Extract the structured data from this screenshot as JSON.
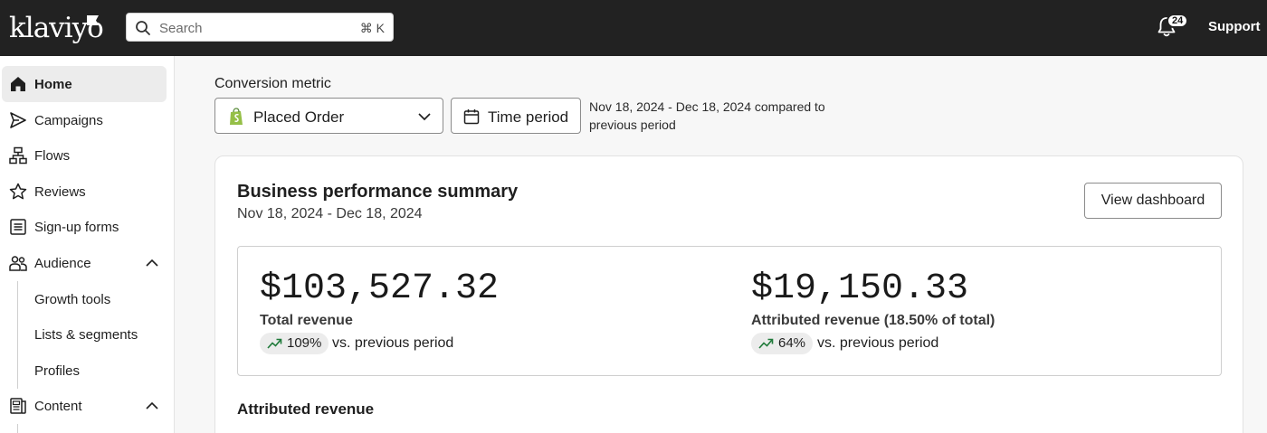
{
  "topbar": {
    "logo_text": "klaviyo",
    "search": {
      "placeholder": "Search",
      "shortcut": "⌘ K"
    },
    "notifications": {
      "count": "24",
      "icon": "bell-icon"
    },
    "support_label": "Support"
  },
  "sidebar": {
    "items": [
      {
        "label": "Home",
        "icon": "home-icon",
        "active": true
      },
      {
        "label": "Campaigns",
        "icon": "send-icon"
      },
      {
        "label": "Flows",
        "icon": "flows-icon"
      },
      {
        "label": "Reviews",
        "icon": "star-icon"
      },
      {
        "label": "Sign-up forms",
        "icon": "form-icon"
      },
      {
        "label": "Audience",
        "icon": "audience-icon",
        "expanded": true
      },
      {
        "label": "Content",
        "icon": "content-icon",
        "expanded": true
      }
    ],
    "audience_children": [
      "Growth tools",
      "Lists & segments",
      "Profiles"
    ]
  },
  "main": {
    "conversion_label": "Conversion metric",
    "metric_select": {
      "value": "Placed Order",
      "icon": "shopify-icon"
    },
    "time_button_label": "Time period",
    "period_text": "Nov 18, 2024 - Dec 18, 2024 compared to previous period"
  },
  "card": {
    "title": "Business performance summary",
    "date_range": "Nov 18, 2024 - Dec 18, 2024",
    "view_button": "View dashboard",
    "metrics": [
      {
        "value": "$103,527.32",
        "label": "Total revenue",
        "change": "109%",
        "vs": "vs. previous period"
      },
      {
        "value": "$19,150.33",
        "label": "Attributed revenue (18.50% of total)",
        "change": "64%",
        "vs": "vs. previous period"
      }
    ],
    "section_title": "Attributed revenue"
  },
  "colors": {
    "topbar": "#222222",
    "trend_green": "#1f7a3a",
    "shopify": "#95bf47"
  }
}
